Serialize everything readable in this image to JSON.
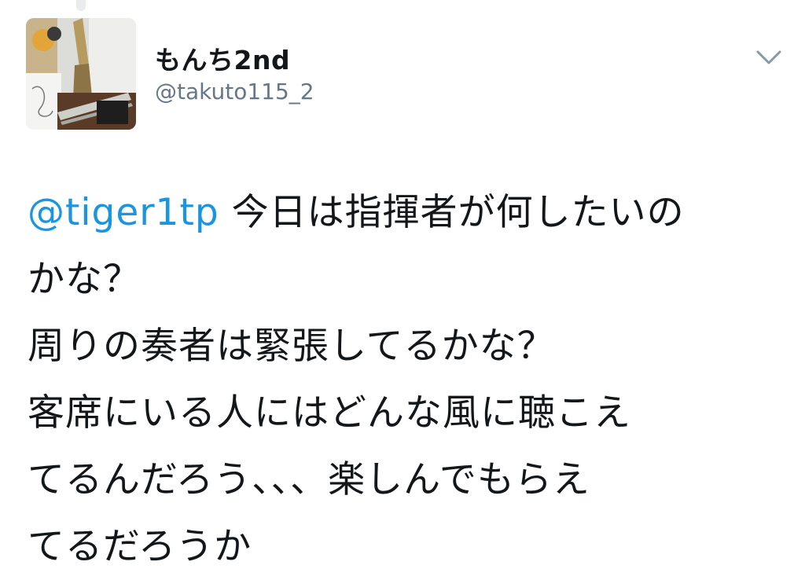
{
  "author": {
    "display_name": "もんち2nd",
    "handle": "@takuto115_2",
    "avatar_icon": "profile-photo-instruments"
  },
  "menu": {
    "icon": "chevron-down-icon"
  },
  "tweet": {
    "mention": "@tiger1tp",
    "line1_rest": " 今日は指揮者が何したいの",
    "line2": "かな？",
    "line3": "周りの奏者は緊張してるかな？",
    "line4": "客席にいる人にはどんな風に聴こえ",
    "line5": "てるんだろう、、、楽しんでもらえ",
    "line6": "てるだろうか"
  },
  "colors": {
    "link": "#1b95e0",
    "text": "#14171a",
    "secondary": "#657786"
  }
}
